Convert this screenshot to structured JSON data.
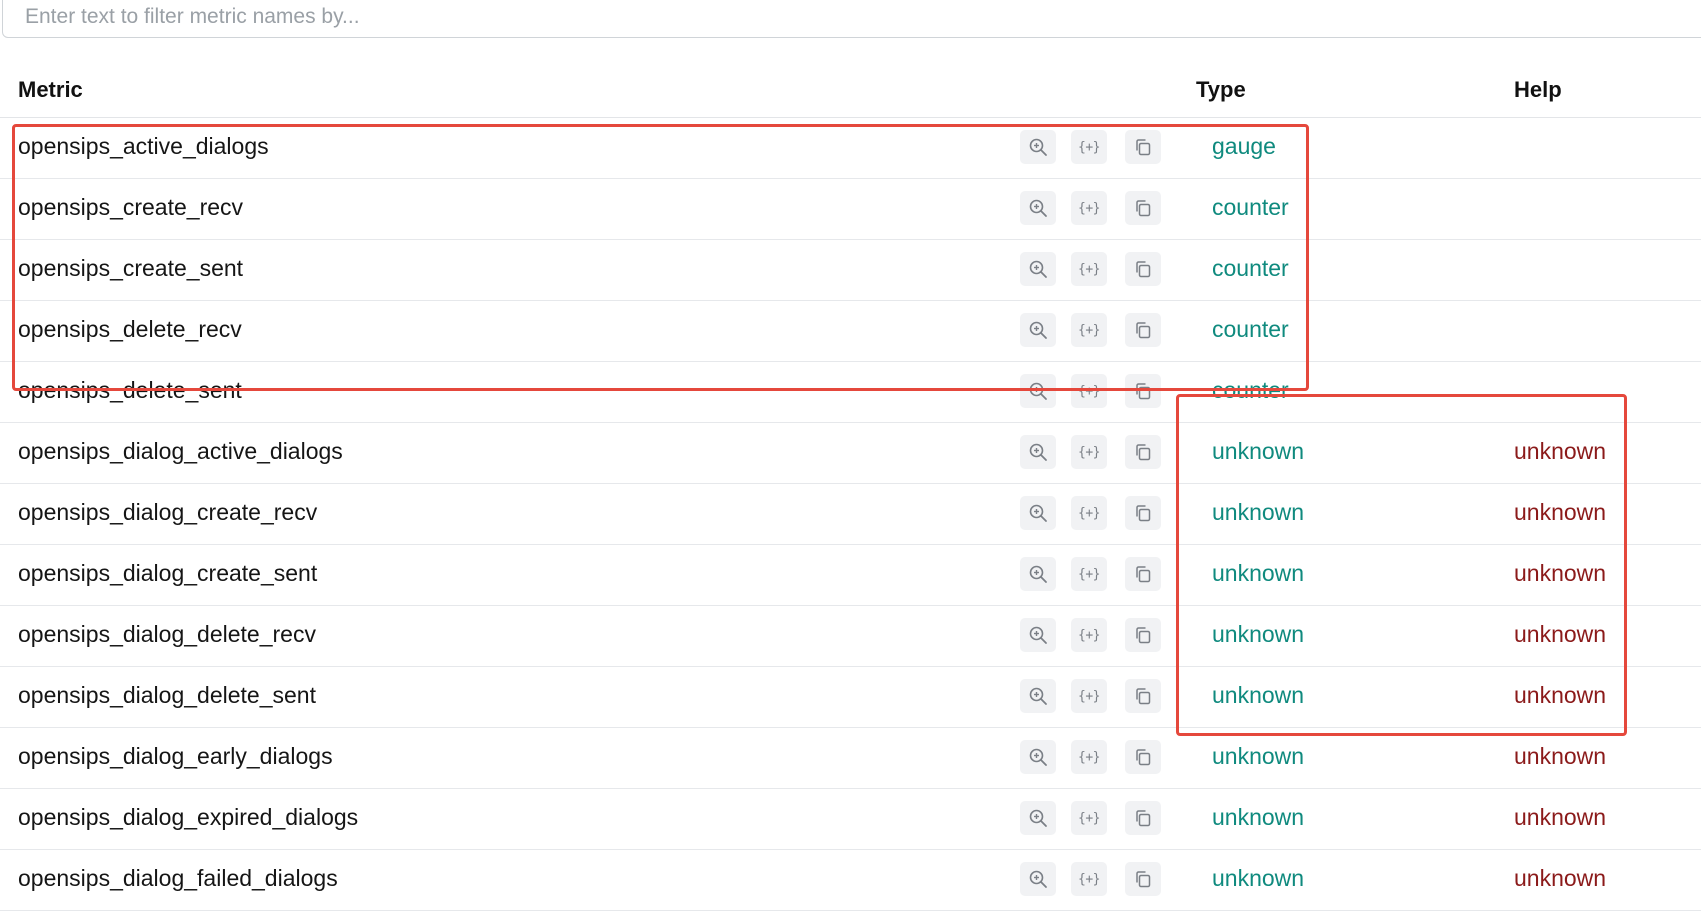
{
  "filter": {
    "placeholder": "Enter text to filter metric names by..."
  },
  "table": {
    "headers": {
      "metric": "Metric",
      "type": "Type",
      "help": "Help"
    },
    "rows": [
      {
        "name": "opensips_active_dialogs",
        "type": "gauge",
        "help": ""
      },
      {
        "name": "opensips_create_recv",
        "type": "counter",
        "help": ""
      },
      {
        "name": "opensips_create_sent",
        "type": "counter",
        "help": ""
      },
      {
        "name": "opensips_delete_recv",
        "type": "counter",
        "help": ""
      },
      {
        "name": "opensips_delete_sent",
        "type": "counter",
        "help": ""
      },
      {
        "name": "opensips_dialog_active_dialogs",
        "type": "unknown",
        "help": "unknown"
      },
      {
        "name": "opensips_dialog_create_recv",
        "type": "unknown",
        "help": "unknown"
      },
      {
        "name": "opensips_dialog_create_sent",
        "type": "unknown",
        "help": "unknown"
      },
      {
        "name": "opensips_dialog_delete_recv",
        "type": "unknown",
        "help": "unknown"
      },
      {
        "name": "opensips_dialog_delete_sent",
        "type": "unknown",
        "help": "unknown"
      },
      {
        "name": "opensips_dialog_early_dialogs",
        "type": "unknown",
        "help": "unknown"
      },
      {
        "name": "opensips_dialog_expired_dialogs",
        "type": "unknown",
        "help": "unknown"
      },
      {
        "name": "opensips_dialog_failed_dialogs",
        "type": "unknown",
        "help": "unknown"
      }
    ],
    "row_actions": {
      "explore_icon": "zoom-in-icon",
      "insert_icon": "braces-plus-icon",
      "insert_glyph": "{+}",
      "copy_icon": "copy-icon"
    }
  },
  "colors": {
    "type_text": "#0f8a7e",
    "help_text": "#8b1a1a",
    "highlight_border": "#e5483c"
  }
}
